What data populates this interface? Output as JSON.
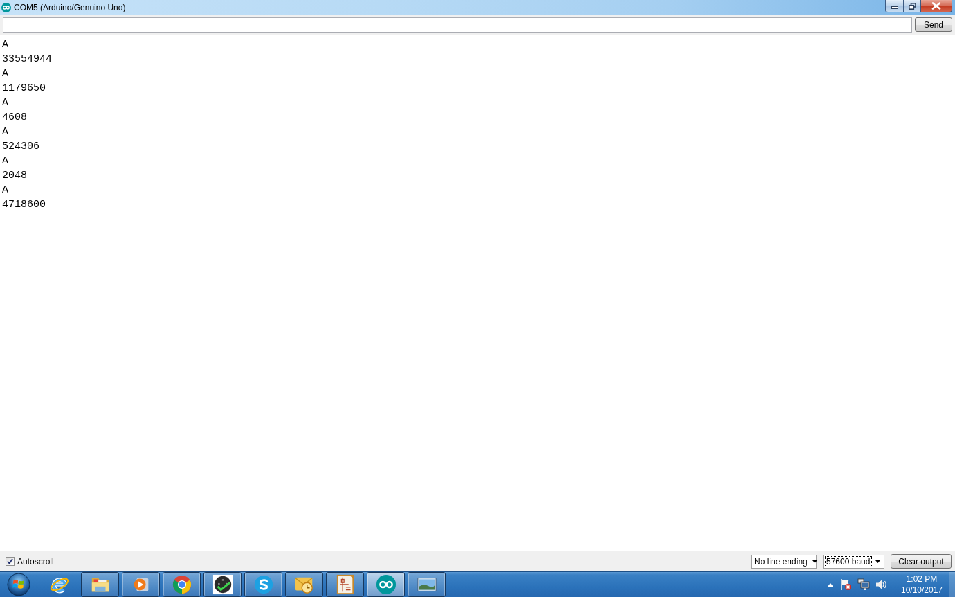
{
  "window": {
    "title": "COM5 (Arduino/Genuino Uno)"
  },
  "send_bar": {
    "button": "Send"
  },
  "output": {
    "lines": [
      "A",
      "33554944",
      "A",
      "1179650",
      "A",
      "4608",
      "A",
      "524306",
      "A",
      "2048",
      "A",
      "4718600"
    ]
  },
  "footer": {
    "autoscroll": {
      "label": "Autoscroll",
      "checked": true
    },
    "line_ending": {
      "value": "No line ending",
      "focused": false
    },
    "baud": {
      "value": "57600 baud",
      "focused": true
    },
    "clear_button": "Clear output"
  },
  "taskbar": {
    "apps": [
      {
        "kind": "ebrowser",
        "running": false,
        "selected": false
      },
      {
        "kind": "folder",
        "running": true,
        "selected": false
      },
      {
        "kind": "player",
        "running": true,
        "selected": false
      },
      {
        "kind": "ringlogo",
        "running": true,
        "selected": false
      },
      {
        "kind": "disc",
        "running": true,
        "selected": false
      },
      {
        "kind": "sbubble",
        "running": true,
        "selected": false
      },
      {
        "kind": "mail",
        "running": true,
        "selected": false
      },
      {
        "kind": "circuit",
        "running": true,
        "selected": false
      },
      {
        "kind": "infinity",
        "running": true,
        "selected": true
      },
      {
        "kind": "photo",
        "running": true,
        "selected": false
      }
    ],
    "clock": {
      "time": "1:02 PM",
      "date": "10/10/2017"
    }
  }
}
